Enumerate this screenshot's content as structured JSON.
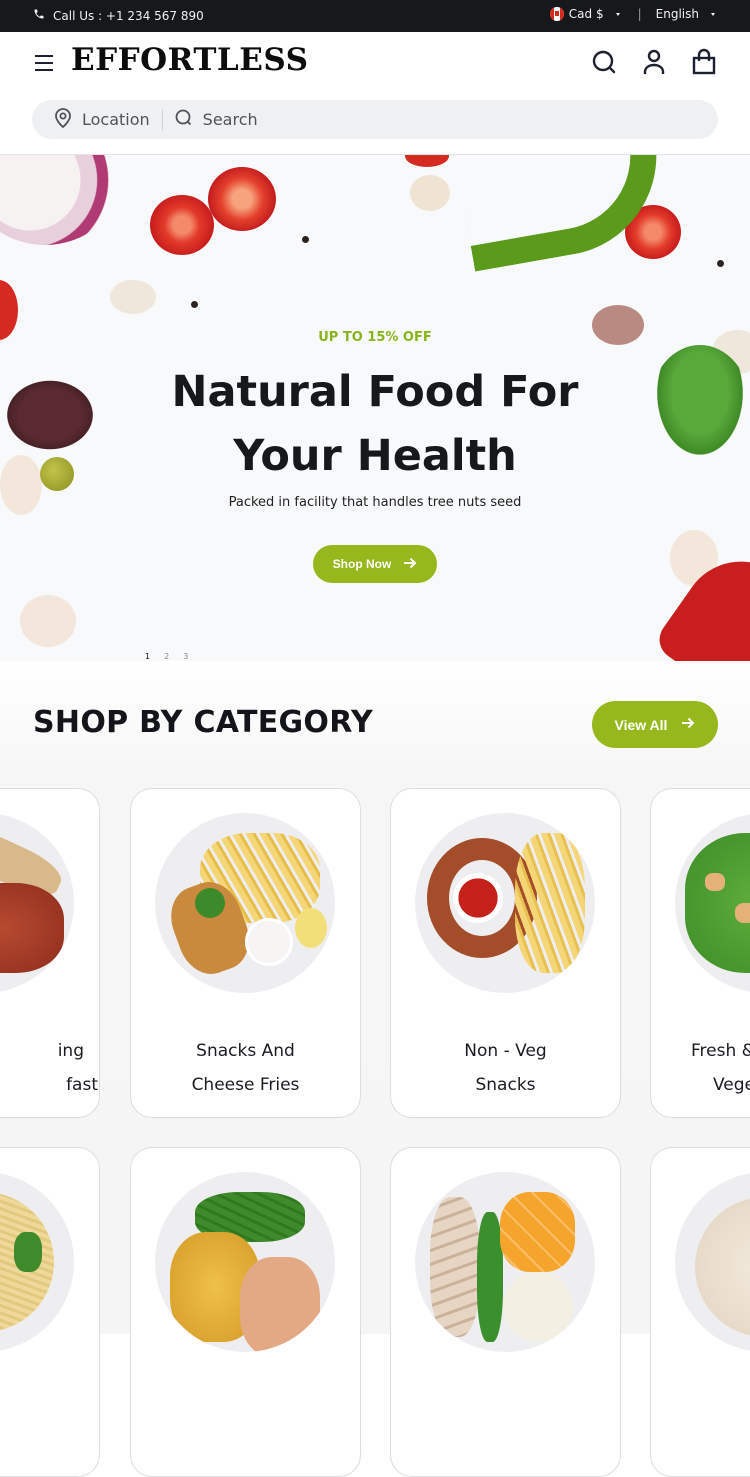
{
  "topbar": {
    "phone_icon": "phone-icon",
    "call_text": "Call Us : +1 234 567 890",
    "currency": "Cad $",
    "currency_flag": "canada-flag-icon",
    "language": "English"
  },
  "header": {
    "brand": "EFFORTLESS",
    "icons": [
      "menu-icon",
      "search-icon",
      "user-icon",
      "shopping-bag-icon"
    ],
    "location_label": "Location",
    "search_placeholder": "Search"
  },
  "hero": {
    "promo": "UP TO 15% OFF",
    "title_line1": "Natural Food For",
    "title_line2": "Your Health",
    "subtitle": "Packed in facility that handles tree nuts seed",
    "cta": "Shop Now",
    "pagination": [
      "1",
      "2",
      "3"
    ],
    "active_slide": 1
  },
  "categories": {
    "heading": "SHOP BY CATEGORY",
    "view_all": "View All",
    "row1": [
      {
        "line1": "ing",
        "line2": "fast",
        "image": "bacon-toast-plate"
      },
      {
        "line1": "Snacks And",
        "line2": "Cheese Fries",
        "image": "fish-fries-plate"
      },
      {
        "line1": "Non - Veg",
        "line2": "Snacks",
        "image": "sausage-fries-plate"
      },
      {
        "line1": "Fresh &",
        "line2": "Vege",
        "image": "salad-plate"
      }
    ],
    "row2": [
      {
        "image": "noodle-soup-plate"
      },
      {
        "image": "potato-beans-chicken-plate"
      },
      {
        "image": "chicken-veg-plate"
      },
      {
        "image": "rice-salad-plate"
      }
    ]
  },
  "colors": {
    "accent": "#97b81c",
    "topbar_bg": "#17181c",
    "text": "#17181c"
  }
}
